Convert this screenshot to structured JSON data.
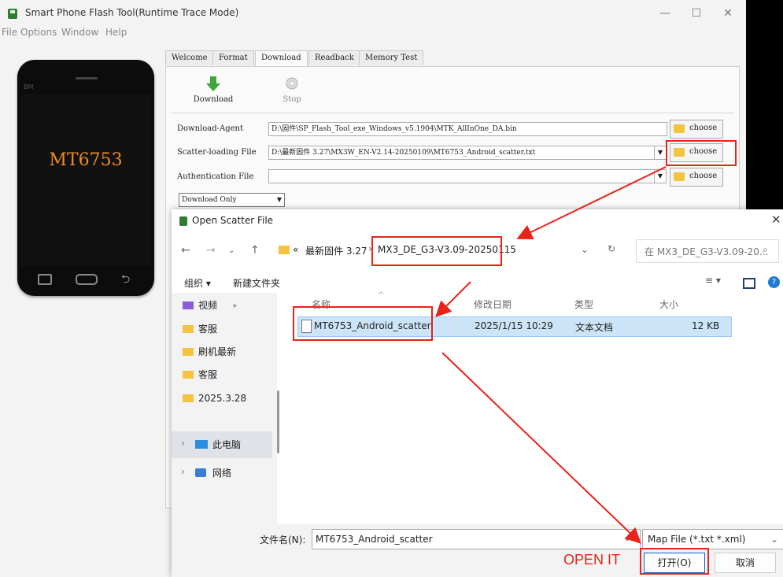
{
  "window": {
    "title": "Smart Phone Flash Tool(Runtime Trace Mode)",
    "controls": [
      "—",
      "☐",
      "✕"
    ]
  },
  "menu": [
    "File",
    "Options",
    "Window",
    "Help"
  ],
  "phone": {
    "brand": "BM",
    "chip": "MT6753"
  },
  "tabs": [
    "Welcome",
    "Format",
    "Download",
    "Readback",
    "Memory Test"
  ],
  "toolbar": {
    "download_label": "Download",
    "stop_label": "Stop"
  },
  "rows": {
    "download_agent": {
      "label": "Download-Agent",
      "value": "D:\\固件\\SP_Flash_Tool_exe_Windows_v5.1904\\MTK_AllInOne_DA.bin"
    },
    "scatter": {
      "label": "Scatter-loading File",
      "value": "D:\\最新固件 3.27\\MX3W_EN-V2.14-20250109\\MT6753_Android_scatter.txt"
    },
    "auth": {
      "label": "Authentication File",
      "value": ""
    },
    "choose_label": "choose"
  },
  "mode": {
    "selected": "Download Only"
  },
  "dialog": {
    "title": "Open Scatter File",
    "breadcrumb_prefix": "«",
    "breadcrumb_parent": "最新固件 3.27",
    "breadcrumb_current": "MX3_DE_G3-V3.09-20250115",
    "search_placeholder": "在 MX3_DE_G3-V3.09-20...",
    "organize": "组织 ▾",
    "new_folder": "新建文件夹",
    "nav_items": [
      "视频",
      "客服",
      "刷机最新",
      "客服",
      "2025.3.28",
      "此电脑",
      "网络"
    ],
    "columns": [
      "名称",
      "修改日期",
      "类型",
      "大小"
    ],
    "file": {
      "name": "MT6753_Android_scatter",
      "date": "2025/1/15 10:29",
      "type": "文本文档",
      "size": "12 KB"
    },
    "filename_label": "文件名(N):",
    "filename_value": "MT6753_Android_scatter",
    "file_type": "Map File (*.txt *.xml)",
    "open_label": "打开(O)",
    "cancel_label": "取消"
  },
  "annotation": {
    "open_it": "OPEN IT",
    "color": "#e8231a"
  },
  "colors": {
    "accent": "#0067c0",
    "selection": "#cce4f7",
    "folder": "#f5c342",
    "chip_text": "#f08a24"
  }
}
